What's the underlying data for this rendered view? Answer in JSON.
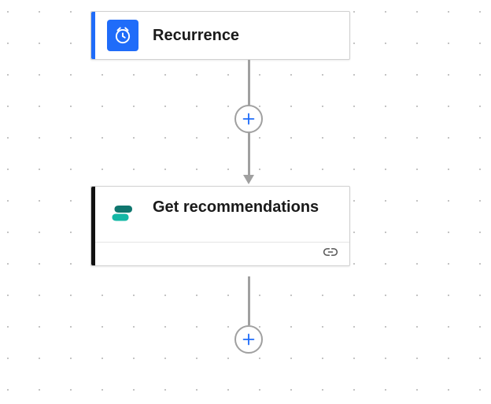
{
  "nodes": {
    "trigger": {
      "title": "Recurrence",
      "accent_color": "#1f6cf9",
      "icon_tile_color": "#1f6cf9",
      "icon_name": "clock-icon"
    },
    "action": {
      "title": "Get recommendations",
      "accent_color": "#111111",
      "icon_name": "process-advisor-icon"
    }
  },
  "buttons": {
    "add_step": "Add step"
  },
  "icons": {
    "link": "link-icon"
  }
}
